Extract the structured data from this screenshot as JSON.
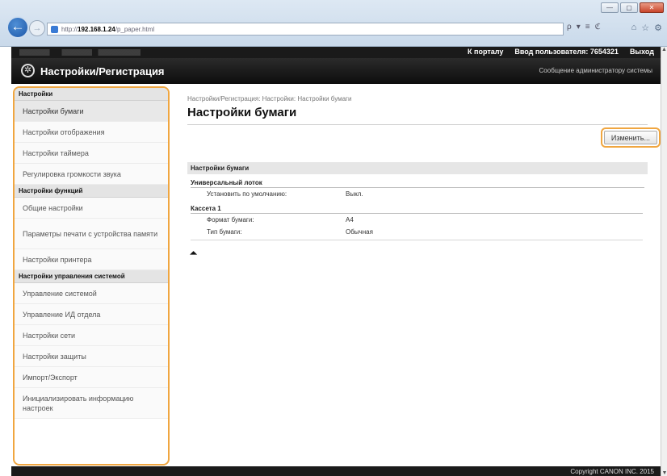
{
  "browser": {
    "url_prefix": "http://",
    "url_host": "192.168.1.24",
    "url_path": "/p_paper.html",
    "tools": [
      "ρ",
      "▾",
      "≡",
      "ℭ"
    ],
    "win_min": "—",
    "win_max": "▢",
    "win_close": "✕",
    "tab_icons": [
      "⌂",
      "☆",
      "⚙"
    ]
  },
  "topbar": {
    "portal_link": "К порталу",
    "login_label": "Ввод пользователя:",
    "user_id": "7654321",
    "logout": "Выход"
  },
  "header": {
    "title": "Настройки/Регистрация",
    "admin_message": "Сообщение администратору системы"
  },
  "sidebar": {
    "sections": [
      {
        "title": "Настройки",
        "items": [
          "Настройки бумаги",
          "Настройки отображения",
          "Настройки таймера",
          "Регулировка громкости звука"
        ]
      },
      {
        "title": "Настройки функций",
        "items": [
          "Общие настройки",
          "Параметры печати с устройства памяти",
          "Настройки принтера"
        ]
      },
      {
        "title": "Настройки управления системой",
        "items": [
          "Управление системой",
          "Управление ИД отдела",
          "Настройки сети",
          "Настройки защиты",
          "Импорт/Экспорт",
          "Инициализировать информацию настроек"
        ]
      }
    ]
  },
  "main": {
    "breadcrumb": "Настройки/Регистрация: Настройки: Настройки бумаги",
    "page_title": "Настройки бумаги",
    "edit_button": "Изменить...",
    "section_title": "Настройки бумаги",
    "groups": [
      {
        "title": "Универсальный лоток",
        "rows": [
          {
            "label": "Установить по умолчанию:",
            "value": "Выкл."
          }
        ]
      },
      {
        "title": "Кассета 1",
        "rows": [
          {
            "label": "Формат бумаги:",
            "value": "A4"
          },
          {
            "label": "Тип бумаги:",
            "value": "Обычная"
          }
        ]
      }
    ],
    "to_top": "⏶"
  },
  "footer": {
    "copyright": "Copyright CANON INC. 2015"
  }
}
